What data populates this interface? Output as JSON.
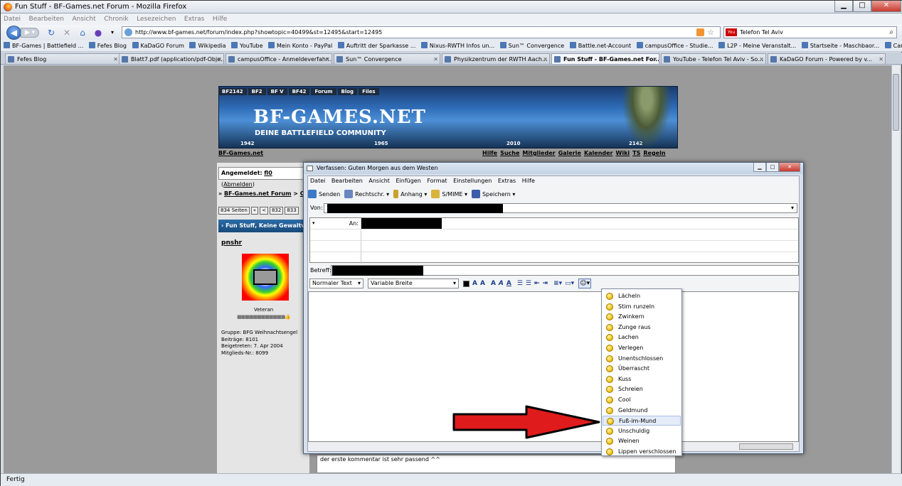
{
  "browser": {
    "title": "Fun Stuff - BF-Games.net Forum - Mozilla Firefox",
    "menu": [
      "Datei",
      "Bearbeiten",
      "Ansicht",
      "Chronik",
      "Lesezeichen",
      "Extras",
      "Hilfe"
    ],
    "url": "http://www.bf-games.net/forum/index.php?showtopic=40499&st=12495&start=12495",
    "search_value": "Telefon Tel Aviv",
    "search_engine_icon": "youtube-icon",
    "bookmarks": [
      "BF-Games | Battlefield ...",
      "Fefes Blog",
      "KaDaGO Forum",
      "Wikipedia",
      "YouTube",
      "Mein Konto - PayPal",
      "Auftritt der Sparkasse ...",
      "Nixus-RWTH Infos un...",
      "Sun™ Convergence",
      "Battle.net-Account",
      "campusOffice - Studie...",
      "L2P - Meine Veranstalt...",
      "Startseite - Maschbaor...",
      "Carpe Diem"
    ],
    "tabs": [
      "Fefes Blog",
      "Blatt7.pdf (application/pdf-Obje...",
      "campusOffice - Anmeldeverfahr...",
      "Sun™ Convergence",
      "Physikzentrum der RWTH Aach...",
      "Fun Stuff - BF-Games.net For...",
      "YouTube - Telefon Tel Aviv - So...",
      "KaDaGO Forum - Powered by v..."
    ],
    "active_tab": 5,
    "status": "Fertig"
  },
  "forum": {
    "nav_tabs": [
      "BF2142",
      "BF2",
      "BF V",
      "BF42",
      "Forum",
      "Blog",
      "Files"
    ],
    "banner_title": "BF-GAMES.NET",
    "banner_subtitle": "DEINE BATTLEFIELD COMMUNITY",
    "years": [
      "1942",
      "1965",
      "2010",
      "2142"
    ],
    "site_link": "BF-Games.net",
    "top_links": [
      "Hilfe",
      "Suche",
      "Mitglieder",
      "Galerie",
      "Kalender",
      "Wiki",
      "TS",
      "Regeln"
    ],
    "login_label": "Angemeldet:",
    "login_user": "fl0",
    "logout_label": "Abmelden",
    "breadcrumb_home": "BF-Games.net Forum",
    "breadcrumb_next": "Co",
    "pager_pages": "834 Seiten",
    "pager_first": "«",
    "pager_prev": "<",
    "pager_page": "832",
    "pager_next": "833",
    "section_bar": "Fun Stuff, Keine Gewaltvi",
    "username": "pnshr",
    "rank": "Veteran",
    "group": "Gruppe: BFG Weihnachtsengel",
    "posts": "Beiträge: 8101",
    "joined": "Beigetreten: 7. Apr 2004",
    "member_no": "Mitglieds-Nr.: 8099",
    "comment": "der erste kommentar ist sehr passend ^^"
  },
  "compose": {
    "title": "Verfassen: Guten Morgen aus dem Westen",
    "menu": [
      "Datei",
      "Bearbeiten",
      "Ansicht",
      "Einfügen",
      "Format",
      "Einstellungen",
      "Extras",
      "Hilfe"
    ],
    "toolbar": {
      "send": "Senden",
      "spell": "Rechtschr.",
      "attach": "Anhang",
      "smime": "S/MIME",
      "save": "Speichern"
    },
    "from_label": "Von:",
    "to_label": "An:",
    "subject_label": "Betreff:",
    "paragraph_style": "Normaler Text",
    "font_width": "Variable Breite"
  },
  "smiley_menu": {
    "items": [
      "Lächeln",
      "Stirn runzeln",
      "Zwinkern",
      "Zunge raus",
      "Lachen",
      "Verlegen",
      "Unentschlossen",
      "Überrascht",
      "Kuss",
      "Schreien",
      "Cool",
      "Geldmund",
      "Fuß-im-Mund",
      "Unschuldig",
      "Weinen",
      "Lippen verschlossen"
    ],
    "highlighted": 12
  },
  "colors": {
    "arrow": "#e01b1b",
    "forum_bar": "#184a7a"
  }
}
